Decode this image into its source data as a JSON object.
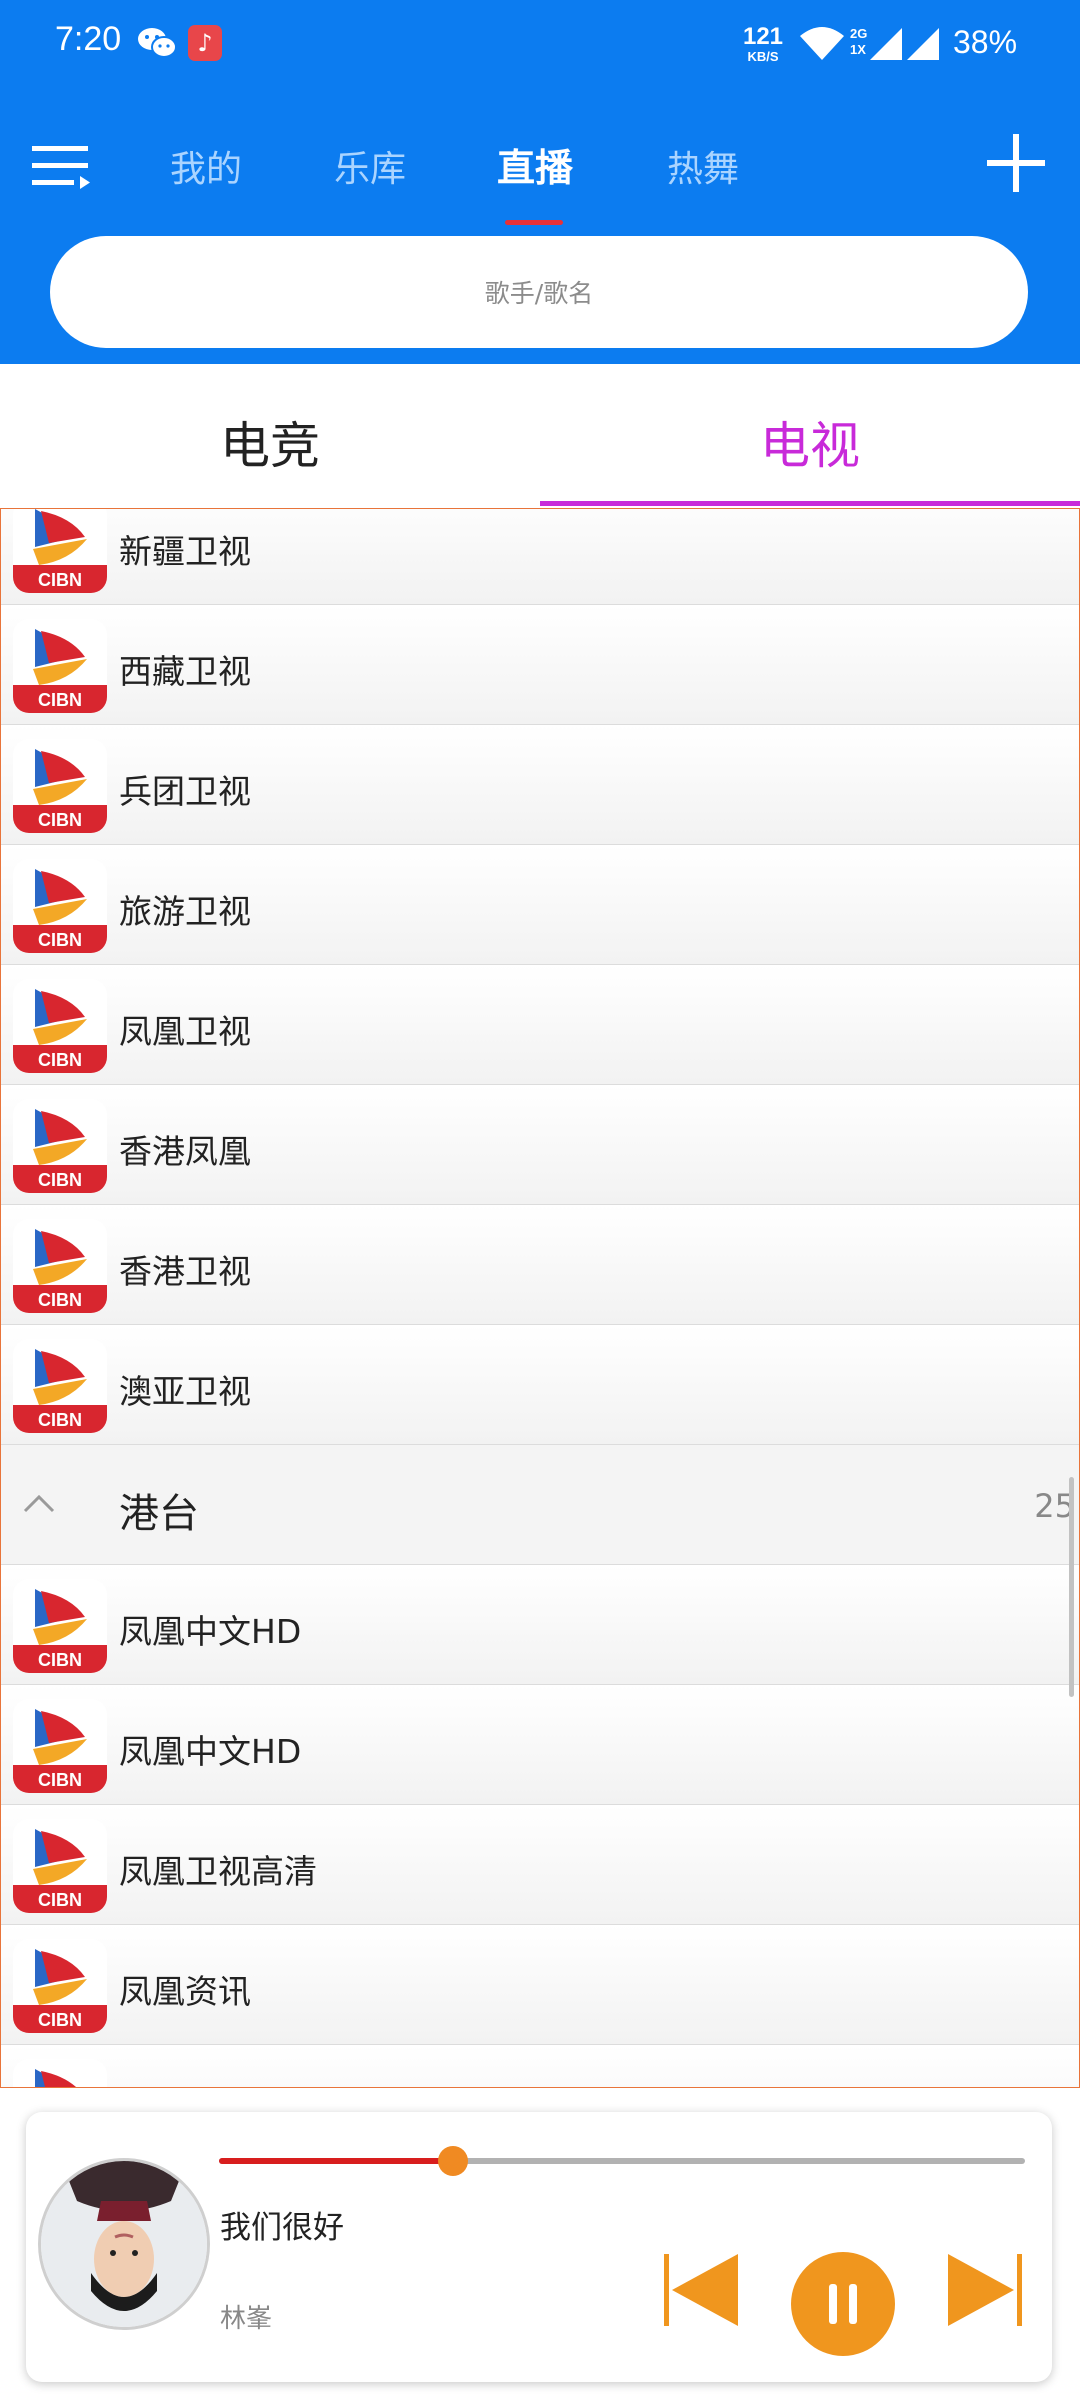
{
  "status_bar": {
    "time": "7:20",
    "net_speed": "121",
    "net_unit": "KB/S",
    "sig_top": "2G",
    "sig_bottom": "1X",
    "battery": "38%",
    "icons": [
      "wechat-icon",
      "music-app-icon",
      "wifi-icon",
      "signal-icon",
      "signal-icon"
    ]
  },
  "header": {
    "tabs": [
      {
        "label": "我的",
        "active": false
      },
      {
        "label": "乐库",
        "active": false
      },
      {
        "label": "直播",
        "active": true
      },
      {
        "label": "热舞",
        "active": false
      }
    ],
    "icons": [
      "menu-icon",
      "add-icon"
    ]
  },
  "search": {
    "placeholder": "歌手/歌名"
  },
  "subtabs": [
    {
      "label": "电竞",
      "active": false
    },
    {
      "label": "电视",
      "active": true
    }
  ],
  "channels_before": [
    "新疆卫视",
    "西藏卫视",
    "兵团卫视",
    "旅游卫视",
    "凤凰卫视",
    "香港凤凰",
    "香港卫视",
    "澳亚卫视"
  ],
  "group": {
    "label": "港台",
    "count": "25"
  },
  "channels_after": [
    "凤凰中文HD",
    "凤凰中文HD",
    "凤凰卫视高清",
    "凤凰资讯",
    ""
  ],
  "logo_text": "CIBN",
  "player": {
    "song": "我们很好",
    "artist": "林峯",
    "progress": 0.29
  },
  "colors": {
    "header_bg": "#0c7cf0",
    "active_subtab": "#c82ad9",
    "tab_indicator": "#e83038",
    "accent_orange": "#f0961e",
    "progress_red": "#d81e1e"
  }
}
